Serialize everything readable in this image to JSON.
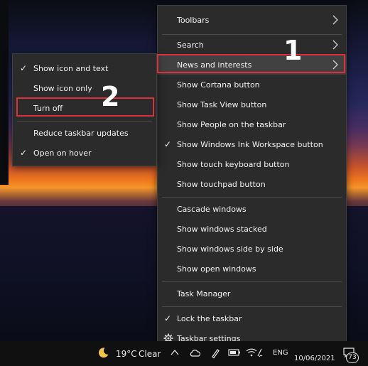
{
  "main_menu": {
    "items": [
      {
        "label": "Toolbars"
      },
      {
        "label": "Search"
      },
      {
        "label": "News and interests"
      },
      {
        "label": "Show Cortana button"
      },
      {
        "label": "Show Task View button"
      },
      {
        "label": "Show People on the taskbar"
      },
      {
        "label": "Show Windows Ink Workspace button",
        "checked": true
      },
      {
        "label": "Show touch keyboard button"
      },
      {
        "label": "Show touchpad button"
      },
      {
        "label": "Cascade windows"
      },
      {
        "label": "Show windows stacked"
      },
      {
        "label": "Show windows side by side"
      },
      {
        "label": "Show open windows"
      },
      {
        "label": "Task Manager"
      },
      {
        "label": "Lock the taskbar",
        "checked": true
      },
      {
        "label": "Taskbar settings",
        "icon": "gear-icon"
      }
    ],
    "check_glyph": "✓"
  },
  "sub_menu": {
    "items": [
      {
        "label": "Show icon and text",
        "checked": true
      },
      {
        "label": "Show icon only"
      },
      {
        "label": "Turn off"
      },
      {
        "label": "Reduce taskbar updates"
      },
      {
        "label": "Open on hover",
        "checked": true
      }
    ]
  },
  "annotations": {
    "step1": "1",
    "step2": "2",
    "highlight_color": "#d9303a"
  },
  "taskbar": {
    "weather_icon": "moon-icon",
    "temperature": "19°C",
    "condition": "Clear",
    "language": "ENG",
    "date": "10/06/2021",
    "notification_count": "73"
  }
}
